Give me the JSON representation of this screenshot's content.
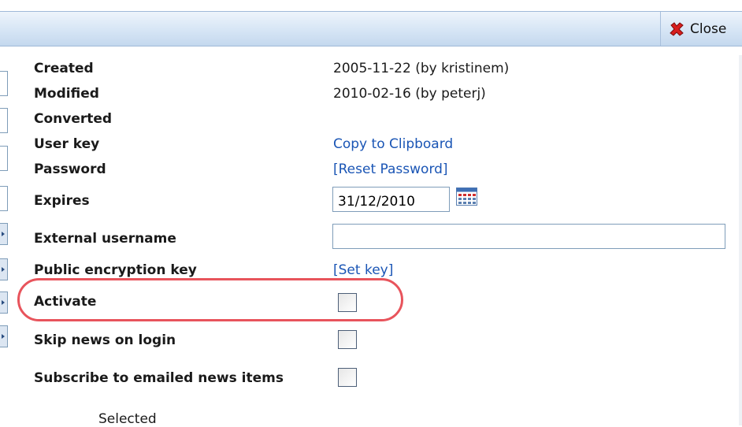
{
  "toolbar": {
    "close_label": "Close"
  },
  "fields": {
    "created": {
      "label": "Created",
      "value": "2005-11-22 (by kristinem)"
    },
    "modified": {
      "label": "Modified",
      "value": "2010-02-16 (by peterj)"
    },
    "converted": {
      "label": "Converted"
    },
    "user_key": {
      "label": "User key",
      "link": "Copy to Clipboard"
    },
    "password": {
      "label": "Password",
      "link": "[Reset Password]"
    },
    "expires": {
      "label": "Expires",
      "value": "31/12/2010"
    },
    "external_username": {
      "label": "External username",
      "value": ""
    },
    "public_key": {
      "label": "Public encryption key",
      "link": "[Set key]"
    },
    "activate": {
      "label": "Activate",
      "checked": false
    },
    "skip_news": {
      "label": "Skip news on login",
      "checked": false
    },
    "subscribe_news": {
      "label": "Subscribe to emailed news items",
      "checked": false
    }
  },
  "footer": {
    "selected_label": "Selected"
  },
  "colors": {
    "link": "#1a55b5",
    "highlight": "#e8545c",
    "titlebar": "#d6e5f5"
  }
}
